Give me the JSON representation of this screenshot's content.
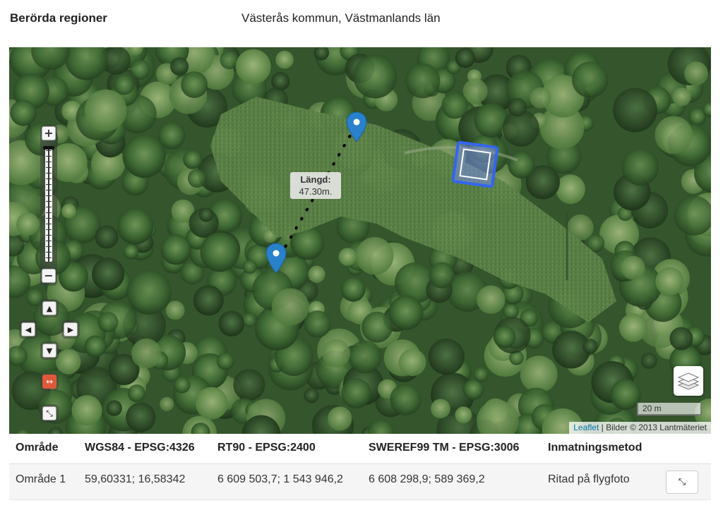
{
  "summary": {
    "label": "Berörda regioner",
    "value": "Västerås kommun, Västmanlands län"
  },
  "map": {
    "zoom_in": "+",
    "zoom_out": "−",
    "pan_up": "▲",
    "pan_left": "◀",
    "pan_right": "▶",
    "pan_down": "▼",
    "measure_icon": "↔",
    "collapse_icon": "⤡",
    "measurement": {
      "title": "Längd:",
      "value": "47.30m."
    },
    "scale_label": "20 m",
    "attribution_link": "Leaflet",
    "attribution_text": " | Bilder © 2013 Lantmäteriet",
    "marker_color": "#2a81cb",
    "polygon_color": "#3366ee"
  },
  "table": {
    "headers": [
      "Område",
      "WGS84 - EPSG:4326",
      "RT90 - EPSG:2400",
      "SWEREF99 TM - EPSG:3006",
      "Inmatningsmetod"
    ],
    "rows": [
      {
        "omrade": "Område 1",
        "wgs84": "59,60331; 16,58342",
        "rt90": "6 609 503,7; 1 543 946,2",
        "sweref": "6 608 298,9; 589 369,2",
        "metod": "Ritad på flygfoto",
        "action_icon": "⤡"
      }
    ]
  }
}
